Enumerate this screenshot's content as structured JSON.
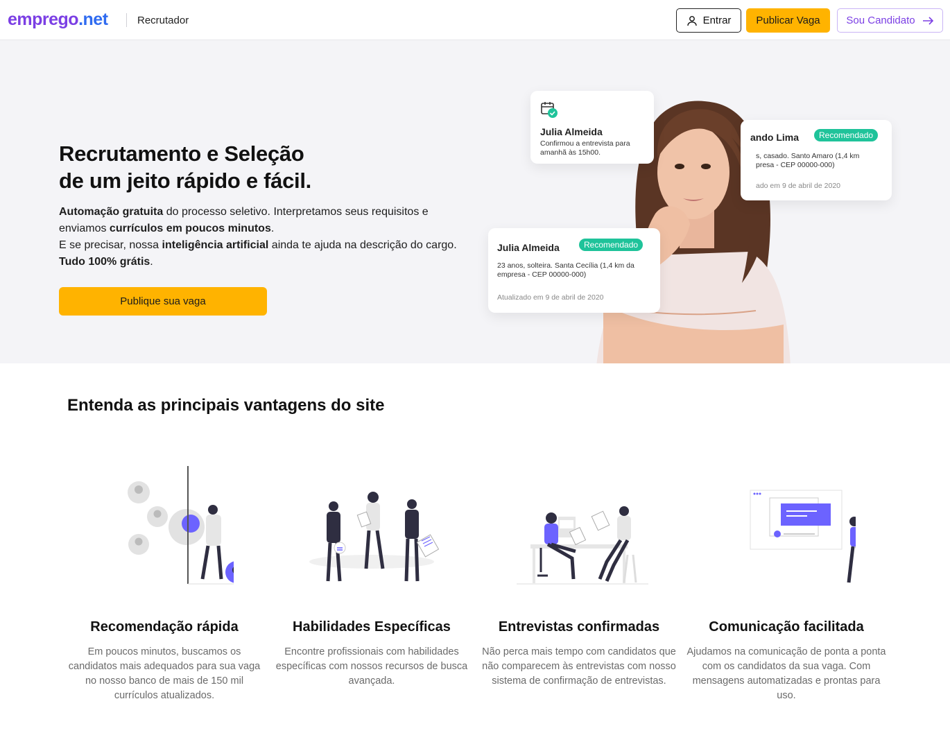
{
  "header": {
    "logo_part1": "emprego",
    "logo_part2": ".net",
    "section_label": "Recrutador",
    "login_label": "Entrar",
    "publish_label": "Publicar Vaga",
    "candidate_label": "Sou Candidato"
  },
  "hero": {
    "title_line1": "Recrutamento e Seleção",
    "title_line2": "de um jeito rápido e fácil.",
    "p1_bold1": "Automação gratuita",
    "p1_text1": " do processo seletivo. Interpretamos seus requisitos e enviamos ",
    "p1_bold2": "currículos em poucos minutos",
    "p1_text2": ".",
    "p2_text1": "E se precisar, nossa ",
    "p2_bold1": "inteligência artificial",
    "p2_text2": " ainda te ajuda na descrição do cargo. ",
    "p2_bold2": "Tudo 100% grátis",
    "p2_text3": ".",
    "cta_label": "Publique sua vaga"
  },
  "cards": {
    "card1": {
      "name": "Julia Almeida",
      "text": "Confirmou a entrevista para amanhã às 15h00."
    },
    "card2": {
      "name": "ando Lima",
      "badge": "Recomendado",
      "text": "s, casado. Santo Amaro (1,4 km presa - CEP 00000-000)",
      "date": "ado em 9 de abril de 2020"
    },
    "card3": {
      "name": "Julia Almeida",
      "badge": "Recomendado",
      "text": "23 anos, solteira. Santa Cecília (1,4 km da empresa - CEP 00000-000)",
      "date": "Atualizado em 9 de abril de 2020"
    }
  },
  "features": {
    "title": "Entenda as principais vantagens do site",
    "items": [
      {
        "title": "Recomendação rápida",
        "text": "Em poucos minutos, buscamos os candidatos mais adequados para sua vaga no nosso banco de mais de 150 mil currículos atualizados."
      },
      {
        "title": "Habilidades Específicas",
        "text": "Encontre profissionais com habilidades específicas com nossos recursos de busca avançada."
      },
      {
        "title": "Entrevistas confirmadas",
        "text": "Não perca mais tempo com candidatos que não comparecem às entrevistas com nosso sistema de confirmação de entrevistas."
      },
      {
        "title": "Comunicação facilitada",
        "text": "Ajudamos na comunicação de ponta a ponta com os candidatos da sua vaga. Com mensagens automatizadas e prontas para uso."
      }
    ]
  },
  "colors": {
    "brand_purple": "#7b3fe4",
    "brand_blue": "#2f6bf0",
    "accent_yellow": "#ffb300",
    "badge_green": "#1fc39a"
  }
}
